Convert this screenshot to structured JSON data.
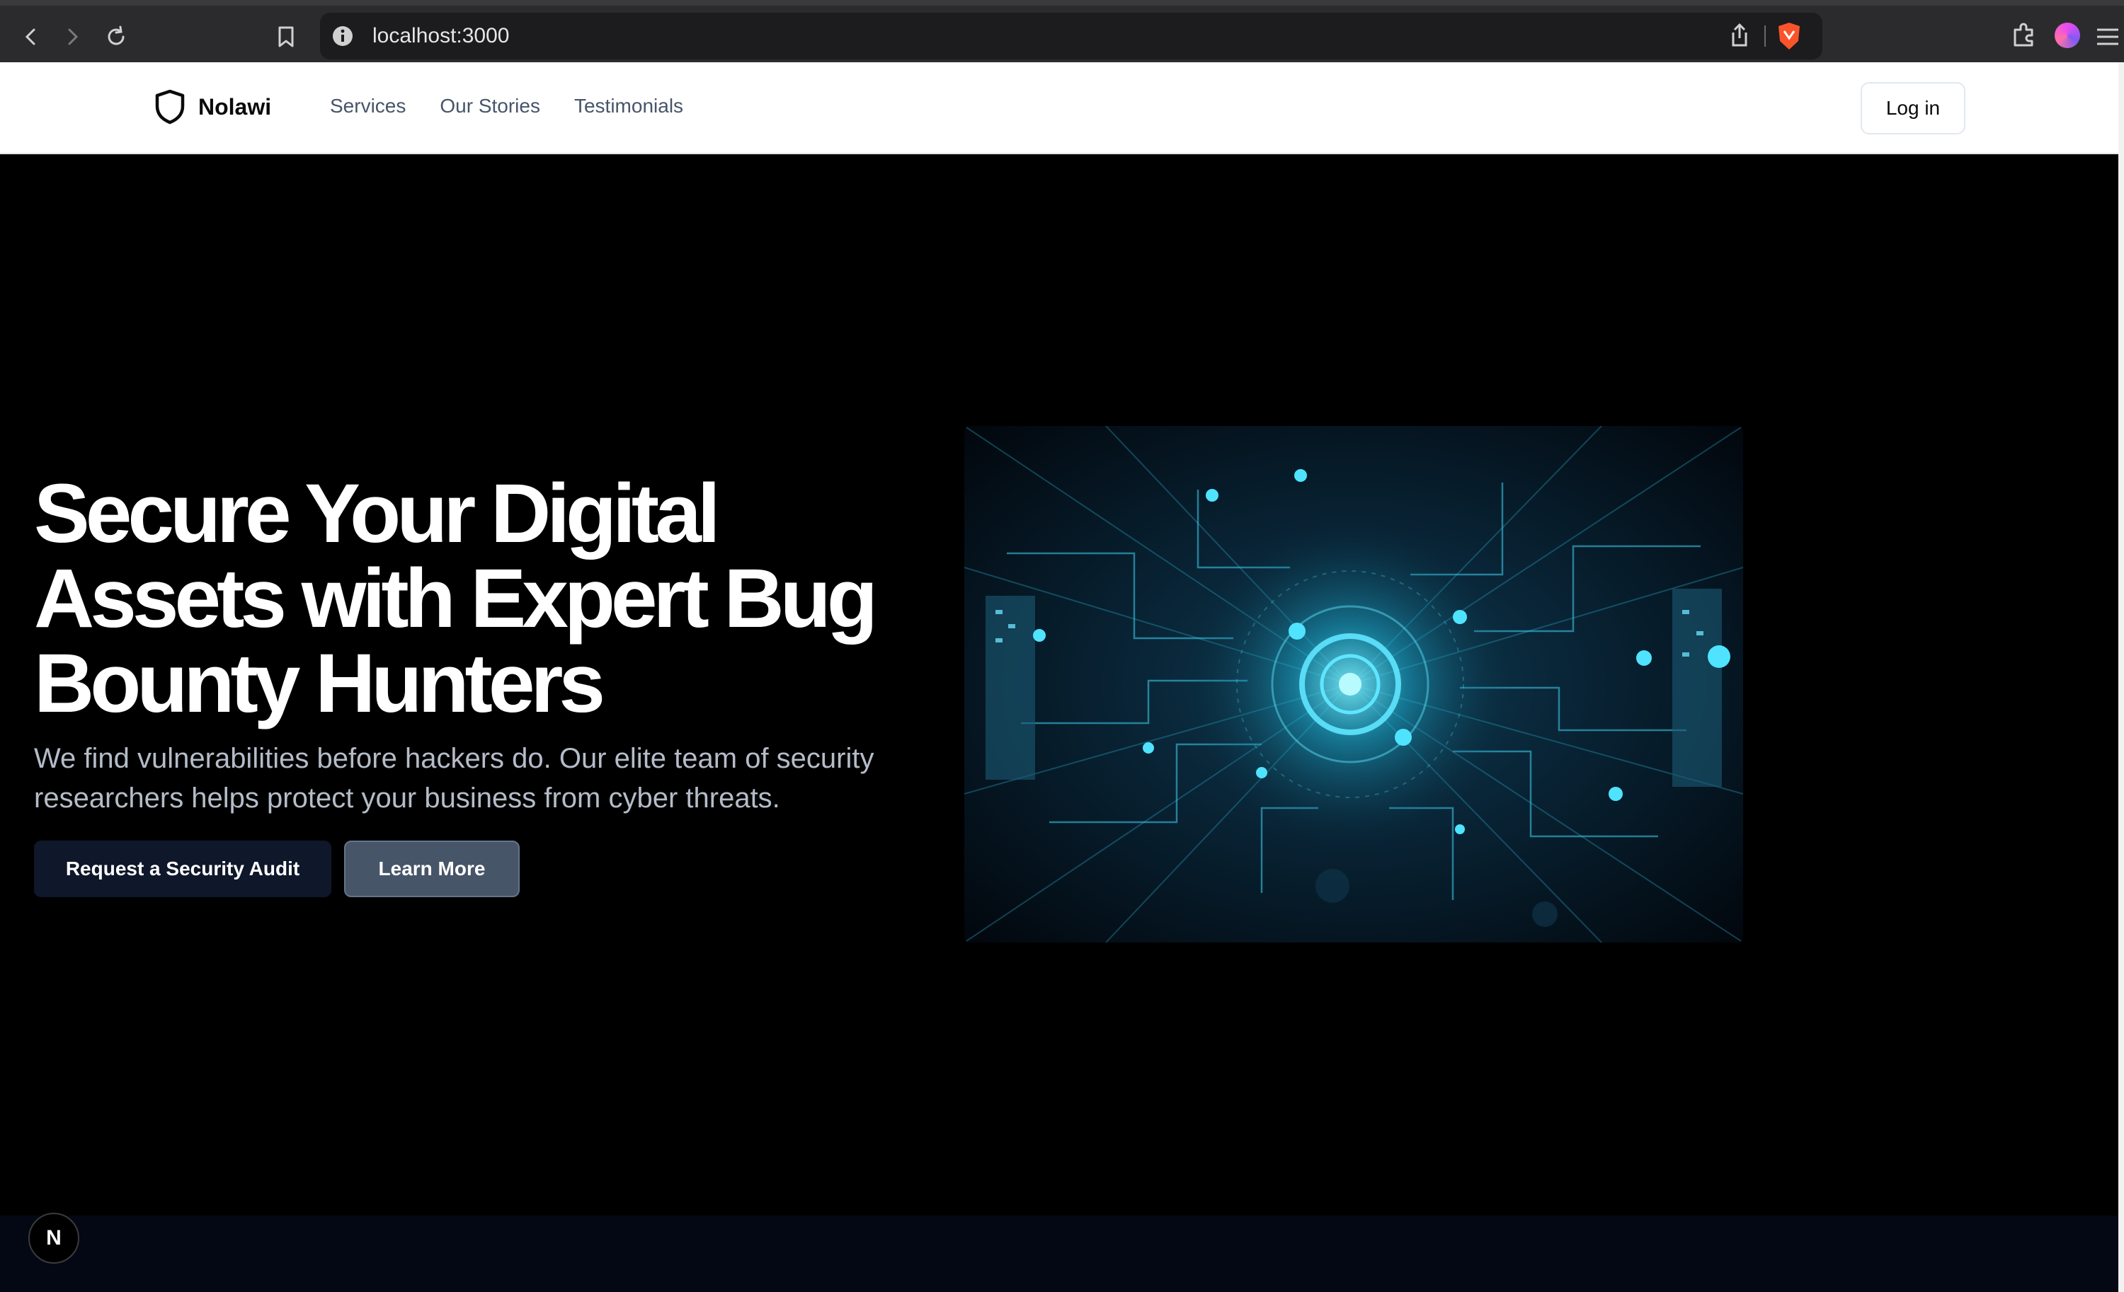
{
  "browser": {
    "url": "localhost:3000",
    "icons": [
      "back-arrow-icon",
      "forward-arrow-icon",
      "reload-icon",
      "bookmark-icon",
      "site-info-icon",
      "share-icon",
      "brave-shield-icon",
      "extensions-icon",
      "profile-icon",
      "menu-icon"
    ]
  },
  "header": {
    "brand_name": "Nolawi",
    "nav": [
      "Services",
      "Our Stories",
      "Testimonials"
    ],
    "login_label": "Log in"
  },
  "hero": {
    "title": "Secure Your Digital Assets with Expert Bug Bounty Hunters",
    "subtitle": "We find vulnerabilities before hackers do. Our elite team of security researchers helps protect your business from cyber threats.",
    "primary_cta": "Request a Security Audit",
    "secondary_cta": "Learn More"
  },
  "dev_badge": "N",
  "colors": {
    "page_bg": "#000000",
    "header_bg": "#ffffff",
    "nav_text": "#475569",
    "primary_button": "#0f172a",
    "secondary_button": "#475569",
    "accent_cyan": "#22d3ee"
  }
}
